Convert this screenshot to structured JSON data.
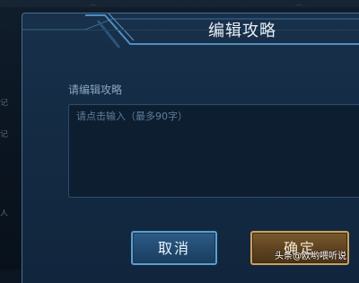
{
  "background": {
    "top_text_left": "…",
    "top_text_right": "…",
    "left_labels": [
      "记",
      "记",
      "人"
    ]
  },
  "dialog": {
    "title": "编辑攻略",
    "field_label": "请编辑攻略",
    "input": {
      "value": "",
      "placeholder": "请点击输入（最多90字）"
    },
    "cancel_label": "取消",
    "confirm_label": "确定"
  },
  "watermark": "头条@欧哟喂听说",
  "colors": {
    "dialog_bg": "#142b44",
    "frame_accent": "#4f8ec0",
    "cancel_border": "#5b9fd0",
    "confirm_border": "#c9a25f"
  }
}
